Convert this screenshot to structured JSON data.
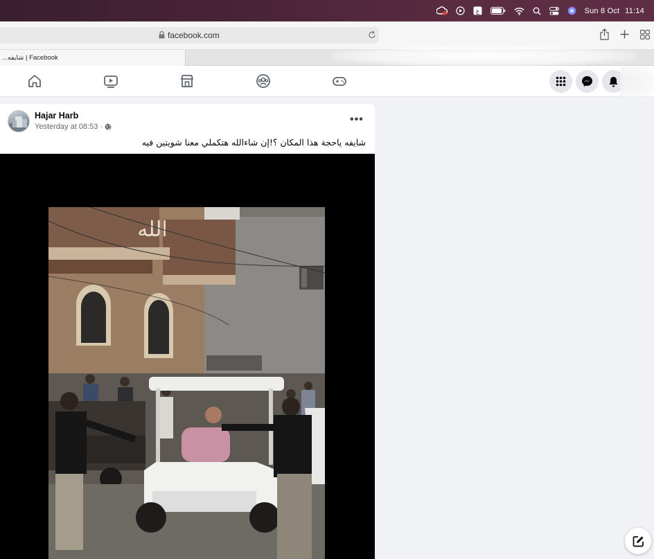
{
  "menubar": {
    "date": "Sun 8 Oct",
    "time": "11:14",
    "icons": [
      "creative-cloud-icon",
      "play-icon",
      "translate-icon",
      "battery-icon",
      "wifi-icon",
      "search-icon",
      "control-center-icon",
      "siri-icon"
    ]
  },
  "browser": {
    "url": "facebook.com",
    "tab_title": "...شايفه | Facebook"
  },
  "fbnav": {
    "icons": [
      "home-icon",
      "video-icon",
      "marketplace-icon",
      "groups-icon",
      "gaming-icon"
    ],
    "right_buttons": [
      "menu-grid-icon",
      "messenger-icon",
      "notifications-icon"
    ]
  },
  "post": {
    "author": "Hajar Harb",
    "timestamp": "Yesterday at 08:53",
    "separator": "·",
    "text": "شايفه ياحجة هذا  المكان ؟!إن شاءالله هتكملي معنا شويتين فيه",
    "photo_banner_text": "الله"
  },
  "colors": {
    "menubar_bg": "#4a2438",
    "fb_blue": "#1877f2",
    "page_bg": "#f0f2f5"
  }
}
